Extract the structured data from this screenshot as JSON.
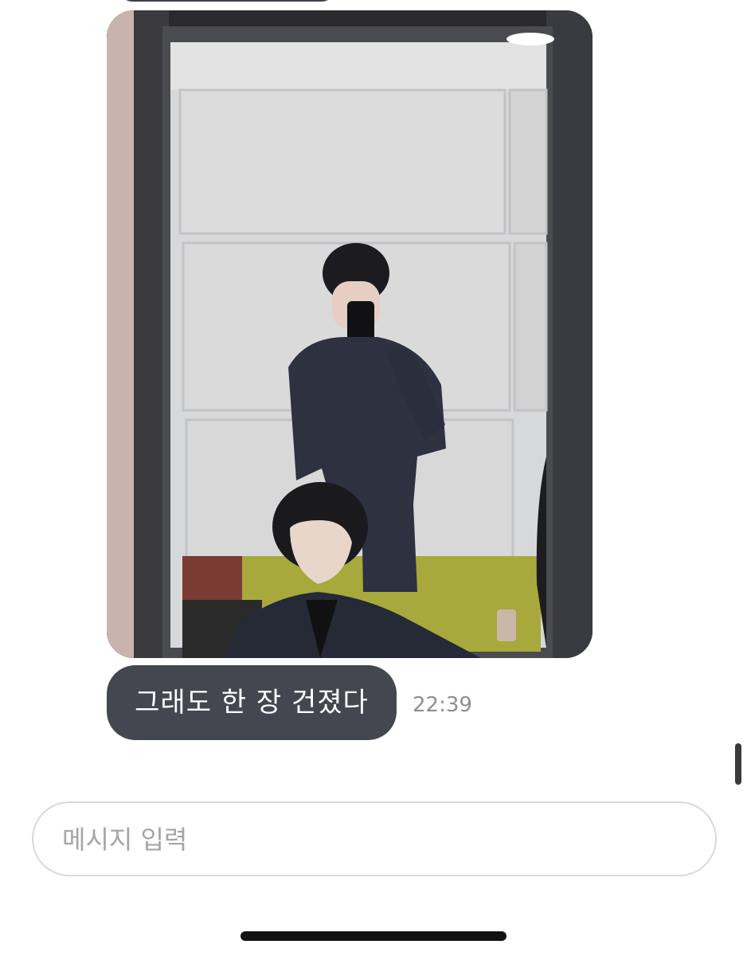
{
  "chat": {
    "messages": [
      {
        "type": "image",
        "alt": "mirror selfie photo"
      },
      {
        "type": "text",
        "text": "그래도 한 장 건졌다",
        "time": "22:39"
      }
    ]
  },
  "composer": {
    "placeholder": "메시지 입력"
  },
  "colors": {
    "bubble_bg": "#44474f",
    "bubble_text": "#ffffff",
    "time_text": "#8d8d93",
    "composer_border": "#d9d9dd",
    "placeholder_text": "#a4a4aa"
  }
}
